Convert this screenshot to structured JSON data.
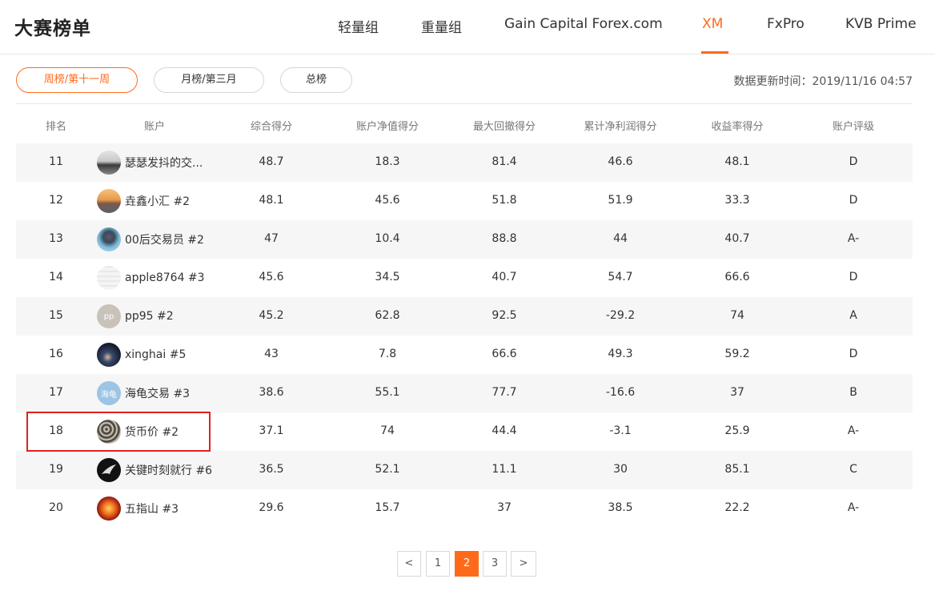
{
  "header": {
    "title": "大赛榜单",
    "tabs": [
      "轻量组",
      "重量组",
      "Gain Capital Forex.com",
      "XM",
      "FxPro",
      "KVB Prime"
    ],
    "active_tab": "XM"
  },
  "filters": {
    "pills": [
      "周榜/第十一周",
      "月榜/第三月",
      "总榜"
    ],
    "active_pill": "周榜/第十一周"
  },
  "update_info": "数据更新时间：2019/11/16 04:57",
  "table": {
    "columns": [
      "排名",
      "账户",
      "综合得分",
      "账户净值得分",
      "最大回撤得分",
      "累计净利润得分",
      "收益率得分",
      "账户评级"
    ],
    "rows": [
      {
        "rank": "11",
        "account": "瑟瑟发抖的交...",
        "avatar": "landscape-avatar",
        "score": "48.7",
        "equity": "18.3",
        "drawdown": "81.4",
        "profit": "46.6",
        "return": "48.1",
        "rating": "D"
      },
      {
        "rank": "12",
        "account": "垚鑫小汇 #2",
        "avatar": "sunset-avatar",
        "score": "48.1",
        "equity": "45.6",
        "drawdown": "51.8",
        "profit": "51.9",
        "return": "33.3",
        "rating": "D"
      },
      {
        "rank": "13",
        "account": "00后交易员 #2",
        "avatar": "person-avatar",
        "score": "47",
        "equity": "10.4",
        "drawdown": "88.8",
        "profit": "44",
        "return": "40.7",
        "rating": "A-"
      },
      {
        "rank": "14",
        "account": "apple8764 #3",
        "avatar": "sketch-avatar",
        "score": "45.6",
        "equity": "34.5",
        "drawdown": "40.7",
        "profit": "54.7",
        "return": "66.6",
        "rating": "D"
      },
      {
        "rank": "15",
        "account": "pp95 #2",
        "avatar": "text-avatar",
        "avatar_text": "pp",
        "score": "45.2",
        "equity": "62.8",
        "drawdown": "92.5",
        "profit": "-29.2",
        "return": "74",
        "rating": "A"
      },
      {
        "rank": "16",
        "account": "xinghai #5",
        "avatar": "night-sky-avatar",
        "score": "43",
        "equity": "7.8",
        "drawdown": "66.6",
        "profit": "49.3",
        "return": "59.2",
        "rating": "D"
      },
      {
        "rank": "17",
        "account": "海龟交易 #3",
        "avatar": "text-avatar",
        "avatar_text": "海龟",
        "score": "38.6",
        "equity": "55.1",
        "drawdown": "77.7",
        "profit": "-16.6",
        "return": "37",
        "rating": "B"
      },
      {
        "rank": "18",
        "account": "货币价 #2",
        "avatar": "texture-avatar",
        "score": "37.1",
        "equity": "74",
        "drawdown": "44.4",
        "profit": "-3.1",
        "return": "25.9",
        "rating": "A-"
      },
      {
        "rank": "19",
        "account": "关键时刻就行 #6",
        "avatar": "bird-avatar",
        "score": "36.5",
        "equity": "52.1",
        "drawdown": "11.1",
        "profit": "30",
        "return": "85.1",
        "rating": "C"
      },
      {
        "rank": "20",
        "account": "五指山 #3",
        "avatar": "fire-hand-avatar",
        "score": "29.6",
        "equity": "15.7",
        "drawdown": "37",
        "profit": "38.5",
        "return": "22.2",
        "rating": "A-"
      }
    ],
    "highlighted_rank": "18"
  },
  "pagination": {
    "prev": "<",
    "pages": [
      "1",
      "2",
      "3"
    ],
    "current": "2",
    "next": ">"
  },
  "colors": {
    "accent": "#ff6a1a",
    "row_shade": "#f6f6f6",
    "highlight": "#e02020"
  }
}
